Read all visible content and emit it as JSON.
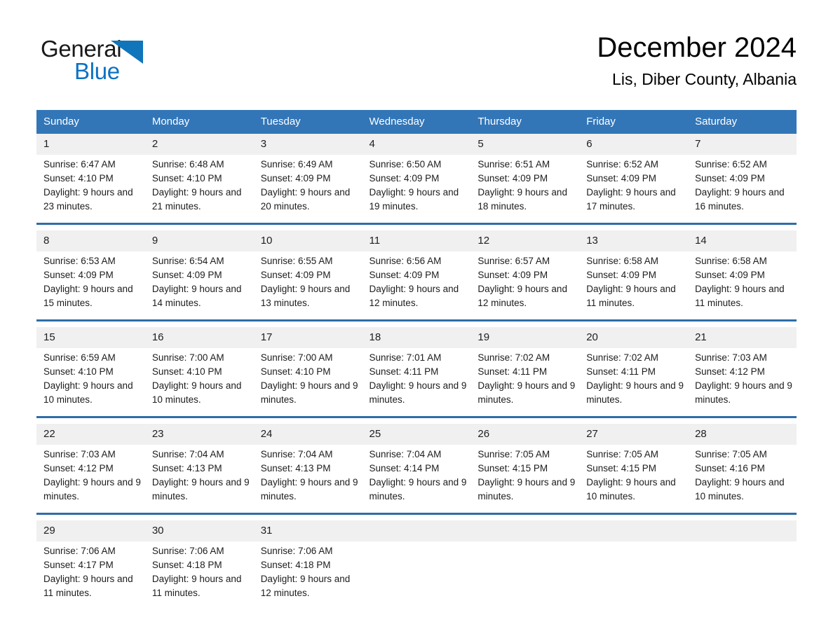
{
  "brand": {
    "word_one": "General",
    "word_two": "Blue",
    "accent_color": "#0b72c4",
    "triangle_color": "#1075bb"
  },
  "header": {
    "title": "December 2024",
    "subtitle": "Lis, Diber County, Albania"
  },
  "theme": {
    "header_bg": "#3276b8",
    "daynum_bg": "#f0f0f0",
    "separator": "#2e6da8"
  },
  "weekdays": [
    "Sunday",
    "Monday",
    "Tuesday",
    "Wednesday",
    "Thursday",
    "Friday",
    "Saturday"
  ],
  "weeks": [
    {
      "days": [
        {
          "day": "1",
          "sunrise": "Sunrise: 6:47 AM",
          "sunset": "Sunset: 4:10 PM",
          "daylight": "Daylight: 9 hours and 23 minutes."
        },
        {
          "day": "2",
          "sunrise": "Sunrise: 6:48 AM",
          "sunset": "Sunset: 4:10 PM",
          "daylight": "Daylight: 9 hours and 21 minutes."
        },
        {
          "day": "3",
          "sunrise": "Sunrise: 6:49 AM",
          "sunset": "Sunset: 4:09 PM",
          "daylight": "Daylight: 9 hours and 20 minutes."
        },
        {
          "day": "4",
          "sunrise": "Sunrise: 6:50 AM",
          "sunset": "Sunset: 4:09 PM",
          "daylight": "Daylight: 9 hours and 19 minutes."
        },
        {
          "day": "5",
          "sunrise": "Sunrise: 6:51 AM",
          "sunset": "Sunset: 4:09 PM",
          "daylight": "Daylight: 9 hours and 18 minutes."
        },
        {
          "day": "6",
          "sunrise": "Sunrise: 6:52 AM",
          "sunset": "Sunset: 4:09 PM",
          "daylight": "Daylight: 9 hours and 17 minutes."
        },
        {
          "day": "7",
          "sunrise": "Sunrise: 6:52 AM",
          "sunset": "Sunset: 4:09 PM",
          "daylight": "Daylight: 9 hours and 16 minutes."
        }
      ]
    },
    {
      "days": [
        {
          "day": "8",
          "sunrise": "Sunrise: 6:53 AM",
          "sunset": "Sunset: 4:09 PM",
          "daylight": "Daylight: 9 hours and 15 minutes."
        },
        {
          "day": "9",
          "sunrise": "Sunrise: 6:54 AM",
          "sunset": "Sunset: 4:09 PM",
          "daylight": "Daylight: 9 hours and 14 minutes."
        },
        {
          "day": "10",
          "sunrise": "Sunrise: 6:55 AM",
          "sunset": "Sunset: 4:09 PM",
          "daylight": "Daylight: 9 hours and 13 minutes."
        },
        {
          "day": "11",
          "sunrise": "Sunrise: 6:56 AM",
          "sunset": "Sunset: 4:09 PM",
          "daylight": "Daylight: 9 hours and 12 minutes."
        },
        {
          "day": "12",
          "sunrise": "Sunrise: 6:57 AM",
          "sunset": "Sunset: 4:09 PM",
          "daylight": "Daylight: 9 hours and 12 minutes."
        },
        {
          "day": "13",
          "sunrise": "Sunrise: 6:58 AM",
          "sunset": "Sunset: 4:09 PM",
          "daylight": "Daylight: 9 hours and 11 minutes."
        },
        {
          "day": "14",
          "sunrise": "Sunrise: 6:58 AM",
          "sunset": "Sunset: 4:09 PM",
          "daylight": "Daylight: 9 hours and 11 minutes."
        }
      ]
    },
    {
      "days": [
        {
          "day": "15",
          "sunrise": "Sunrise: 6:59 AM",
          "sunset": "Sunset: 4:10 PM",
          "daylight": "Daylight: 9 hours and 10 minutes."
        },
        {
          "day": "16",
          "sunrise": "Sunrise: 7:00 AM",
          "sunset": "Sunset: 4:10 PM",
          "daylight": "Daylight: 9 hours and 10 minutes."
        },
        {
          "day": "17",
          "sunrise": "Sunrise: 7:00 AM",
          "sunset": "Sunset: 4:10 PM",
          "daylight": "Daylight: 9 hours and 9 minutes."
        },
        {
          "day": "18",
          "sunrise": "Sunrise: 7:01 AM",
          "sunset": "Sunset: 4:11 PM",
          "daylight": "Daylight: 9 hours and 9 minutes."
        },
        {
          "day": "19",
          "sunrise": "Sunrise: 7:02 AM",
          "sunset": "Sunset: 4:11 PM",
          "daylight": "Daylight: 9 hours and 9 minutes."
        },
        {
          "day": "20",
          "sunrise": "Sunrise: 7:02 AM",
          "sunset": "Sunset: 4:11 PM",
          "daylight": "Daylight: 9 hours and 9 minutes."
        },
        {
          "day": "21",
          "sunrise": "Sunrise: 7:03 AM",
          "sunset": "Sunset: 4:12 PM",
          "daylight": "Daylight: 9 hours and 9 minutes."
        }
      ]
    },
    {
      "days": [
        {
          "day": "22",
          "sunrise": "Sunrise: 7:03 AM",
          "sunset": "Sunset: 4:12 PM",
          "daylight": "Daylight: 9 hours and 9 minutes."
        },
        {
          "day": "23",
          "sunrise": "Sunrise: 7:04 AM",
          "sunset": "Sunset: 4:13 PM",
          "daylight": "Daylight: 9 hours and 9 minutes."
        },
        {
          "day": "24",
          "sunrise": "Sunrise: 7:04 AM",
          "sunset": "Sunset: 4:13 PM",
          "daylight": "Daylight: 9 hours and 9 minutes."
        },
        {
          "day": "25",
          "sunrise": "Sunrise: 7:04 AM",
          "sunset": "Sunset: 4:14 PM",
          "daylight": "Daylight: 9 hours and 9 minutes."
        },
        {
          "day": "26",
          "sunrise": "Sunrise: 7:05 AM",
          "sunset": "Sunset: 4:15 PM",
          "daylight": "Daylight: 9 hours and 9 minutes."
        },
        {
          "day": "27",
          "sunrise": "Sunrise: 7:05 AM",
          "sunset": "Sunset: 4:15 PM",
          "daylight": "Daylight: 9 hours and 10 minutes."
        },
        {
          "day": "28",
          "sunrise": "Sunrise: 7:05 AM",
          "sunset": "Sunset: 4:16 PM",
          "daylight": "Daylight: 9 hours and 10 minutes."
        }
      ]
    },
    {
      "days": [
        {
          "day": "29",
          "sunrise": "Sunrise: 7:06 AM",
          "sunset": "Sunset: 4:17 PM",
          "daylight": "Daylight: 9 hours and 11 minutes."
        },
        {
          "day": "30",
          "sunrise": "Sunrise: 7:06 AM",
          "sunset": "Sunset: 4:18 PM",
          "daylight": "Daylight: 9 hours and 11 minutes."
        },
        {
          "day": "31",
          "sunrise": "Sunrise: 7:06 AM",
          "sunset": "Sunset: 4:18 PM",
          "daylight": "Daylight: 9 hours and 12 minutes."
        },
        {
          "day": "",
          "sunrise": "",
          "sunset": "",
          "daylight": ""
        },
        {
          "day": "",
          "sunrise": "",
          "sunset": "",
          "daylight": ""
        },
        {
          "day": "",
          "sunrise": "",
          "sunset": "",
          "daylight": ""
        },
        {
          "day": "",
          "sunrise": "",
          "sunset": "",
          "daylight": ""
        }
      ]
    }
  ]
}
